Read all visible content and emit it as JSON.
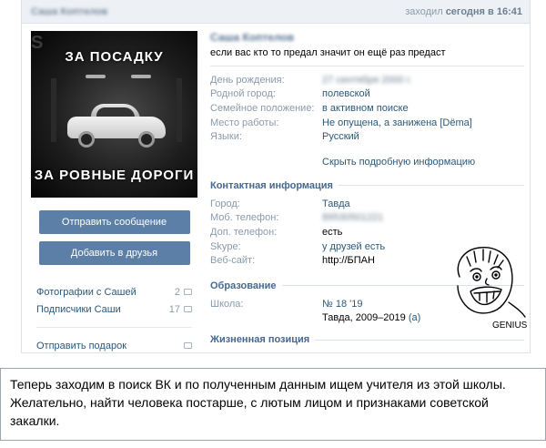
{
  "header": {
    "name": "Саша Коптелов",
    "status_prefix": "заходил",
    "status_time": "сегодня в 16:41"
  },
  "avatar": {
    "caption_top": "ЗА ПОСАДКУ",
    "caption_bottom": "ЗА РОВНЫЕ ДОРОГИ",
    "watermark": "S"
  },
  "actions": {
    "send_message": "Отправить сообщение",
    "add_friend": "Добавить в друзья"
  },
  "left_links": {
    "photos": {
      "label": "Фотографии с Сашей",
      "count": "2"
    },
    "followers": {
      "label": "Подписчики Саши",
      "count": "17"
    },
    "gift": {
      "label": "Отправить подарок"
    }
  },
  "profile": {
    "name": "Саша Коптелов",
    "status": "если вас кто то предал значит он ещё раз предаст",
    "info": [
      {
        "k": "День рождения:",
        "v": "27 сентября 2000 г.",
        "style": "blur"
      },
      {
        "k": "Родной город:",
        "v": "полевской",
        "style": "link"
      },
      {
        "k": "Семейное положение:",
        "v": "в активном поиске",
        "style": "link"
      },
      {
        "k": "Место работы:",
        "v": "Не опущена, а занижена [Dёma]",
        "style": "link"
      },
      {
        "k": "Языки:",
        "v": "Русский",
        "style": "link"
      }
    ],
    "hide_link": "Скрыть подробную информацию"
  },
  "contacts": {
    "title": "Контактная информация",
    "rows": [
      {
        "k": "Город:",
        "v": "Тавда",
        "style": "link"
      },
      {
        "k": "Моб. телефон:",
        "v": "89530501221",
        "style": "blur"
      },
      {
        "k": "Доп. телефон:",
        "v": "есть",
        "style": "plain"
      },
      {
        "k": "Skype:",
        "v": "у друзей есть",
        "style": "link"
      },
      {
        "k": "Веб-сайт:",
        "v": "http://БПАН",
        "style": "plain"
      }
    ]
  },
  "education": {
    "title": "Образование",
    "school_key": "Школа:",
    "school_name": "№ 18 '19",
    "school_years": "Тавда, 2009–2019",
    "school_suffix": "(а)"
  },
  "life": {
    "title": "Жизненная позиция"
  },
  "meme": {
    "label": "GENIUS"
  },
  "caption": {
    "text": "Теперь заходим в поиск ВК и по полученным данным ищем учителя из этой школы. Желательно, найти человека постарше, с лютым лицом и признаками советской закалки."
  }
}
